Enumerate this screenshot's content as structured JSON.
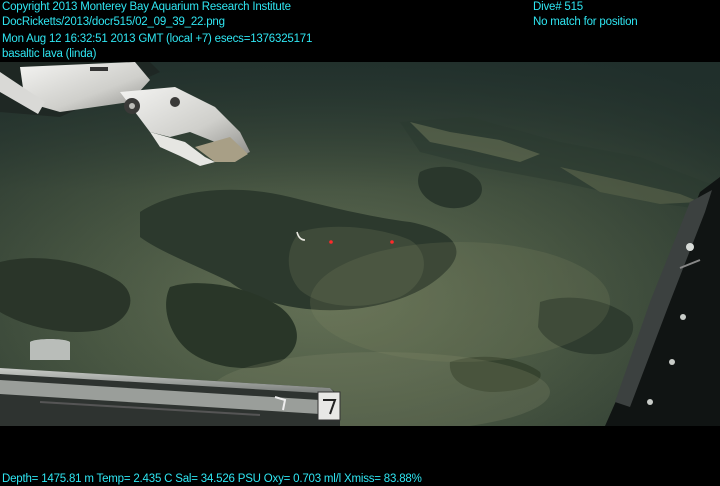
{
  "header": {
    "copyright": "Copyright 2013 Monterey Bay Aquarium Research Institute",
    "file_path": "DocRicketts/2013/docr515/02_09_39_22.png",
    "timestamp": "Mon Aug 12 16:32:51 2013 GMT (local +7)  esecs=1376325171",
    "annotation": "basaltic lava (linda)",
    "dive": "Dive# 515",
    "position_status": "No match for position"
  },
  "footer": {
    "sensor_readout": "Depth= 1475.81 m  Temp= 2.435 C  Sal= 34.526 PSU  Oxy= 0.703 ml/l  Xmiss= 83.88%"
  },
  "colors": {
    "overlay_text": "#2fe6f2",
    "letterbox": "#000000",
    "seafloor": "#3c4b3a"
  },
  "icons": {
    "manipulator_claw": "robot-claw-icon",
    "sampling_tray": "tray-icon"
  }
}
